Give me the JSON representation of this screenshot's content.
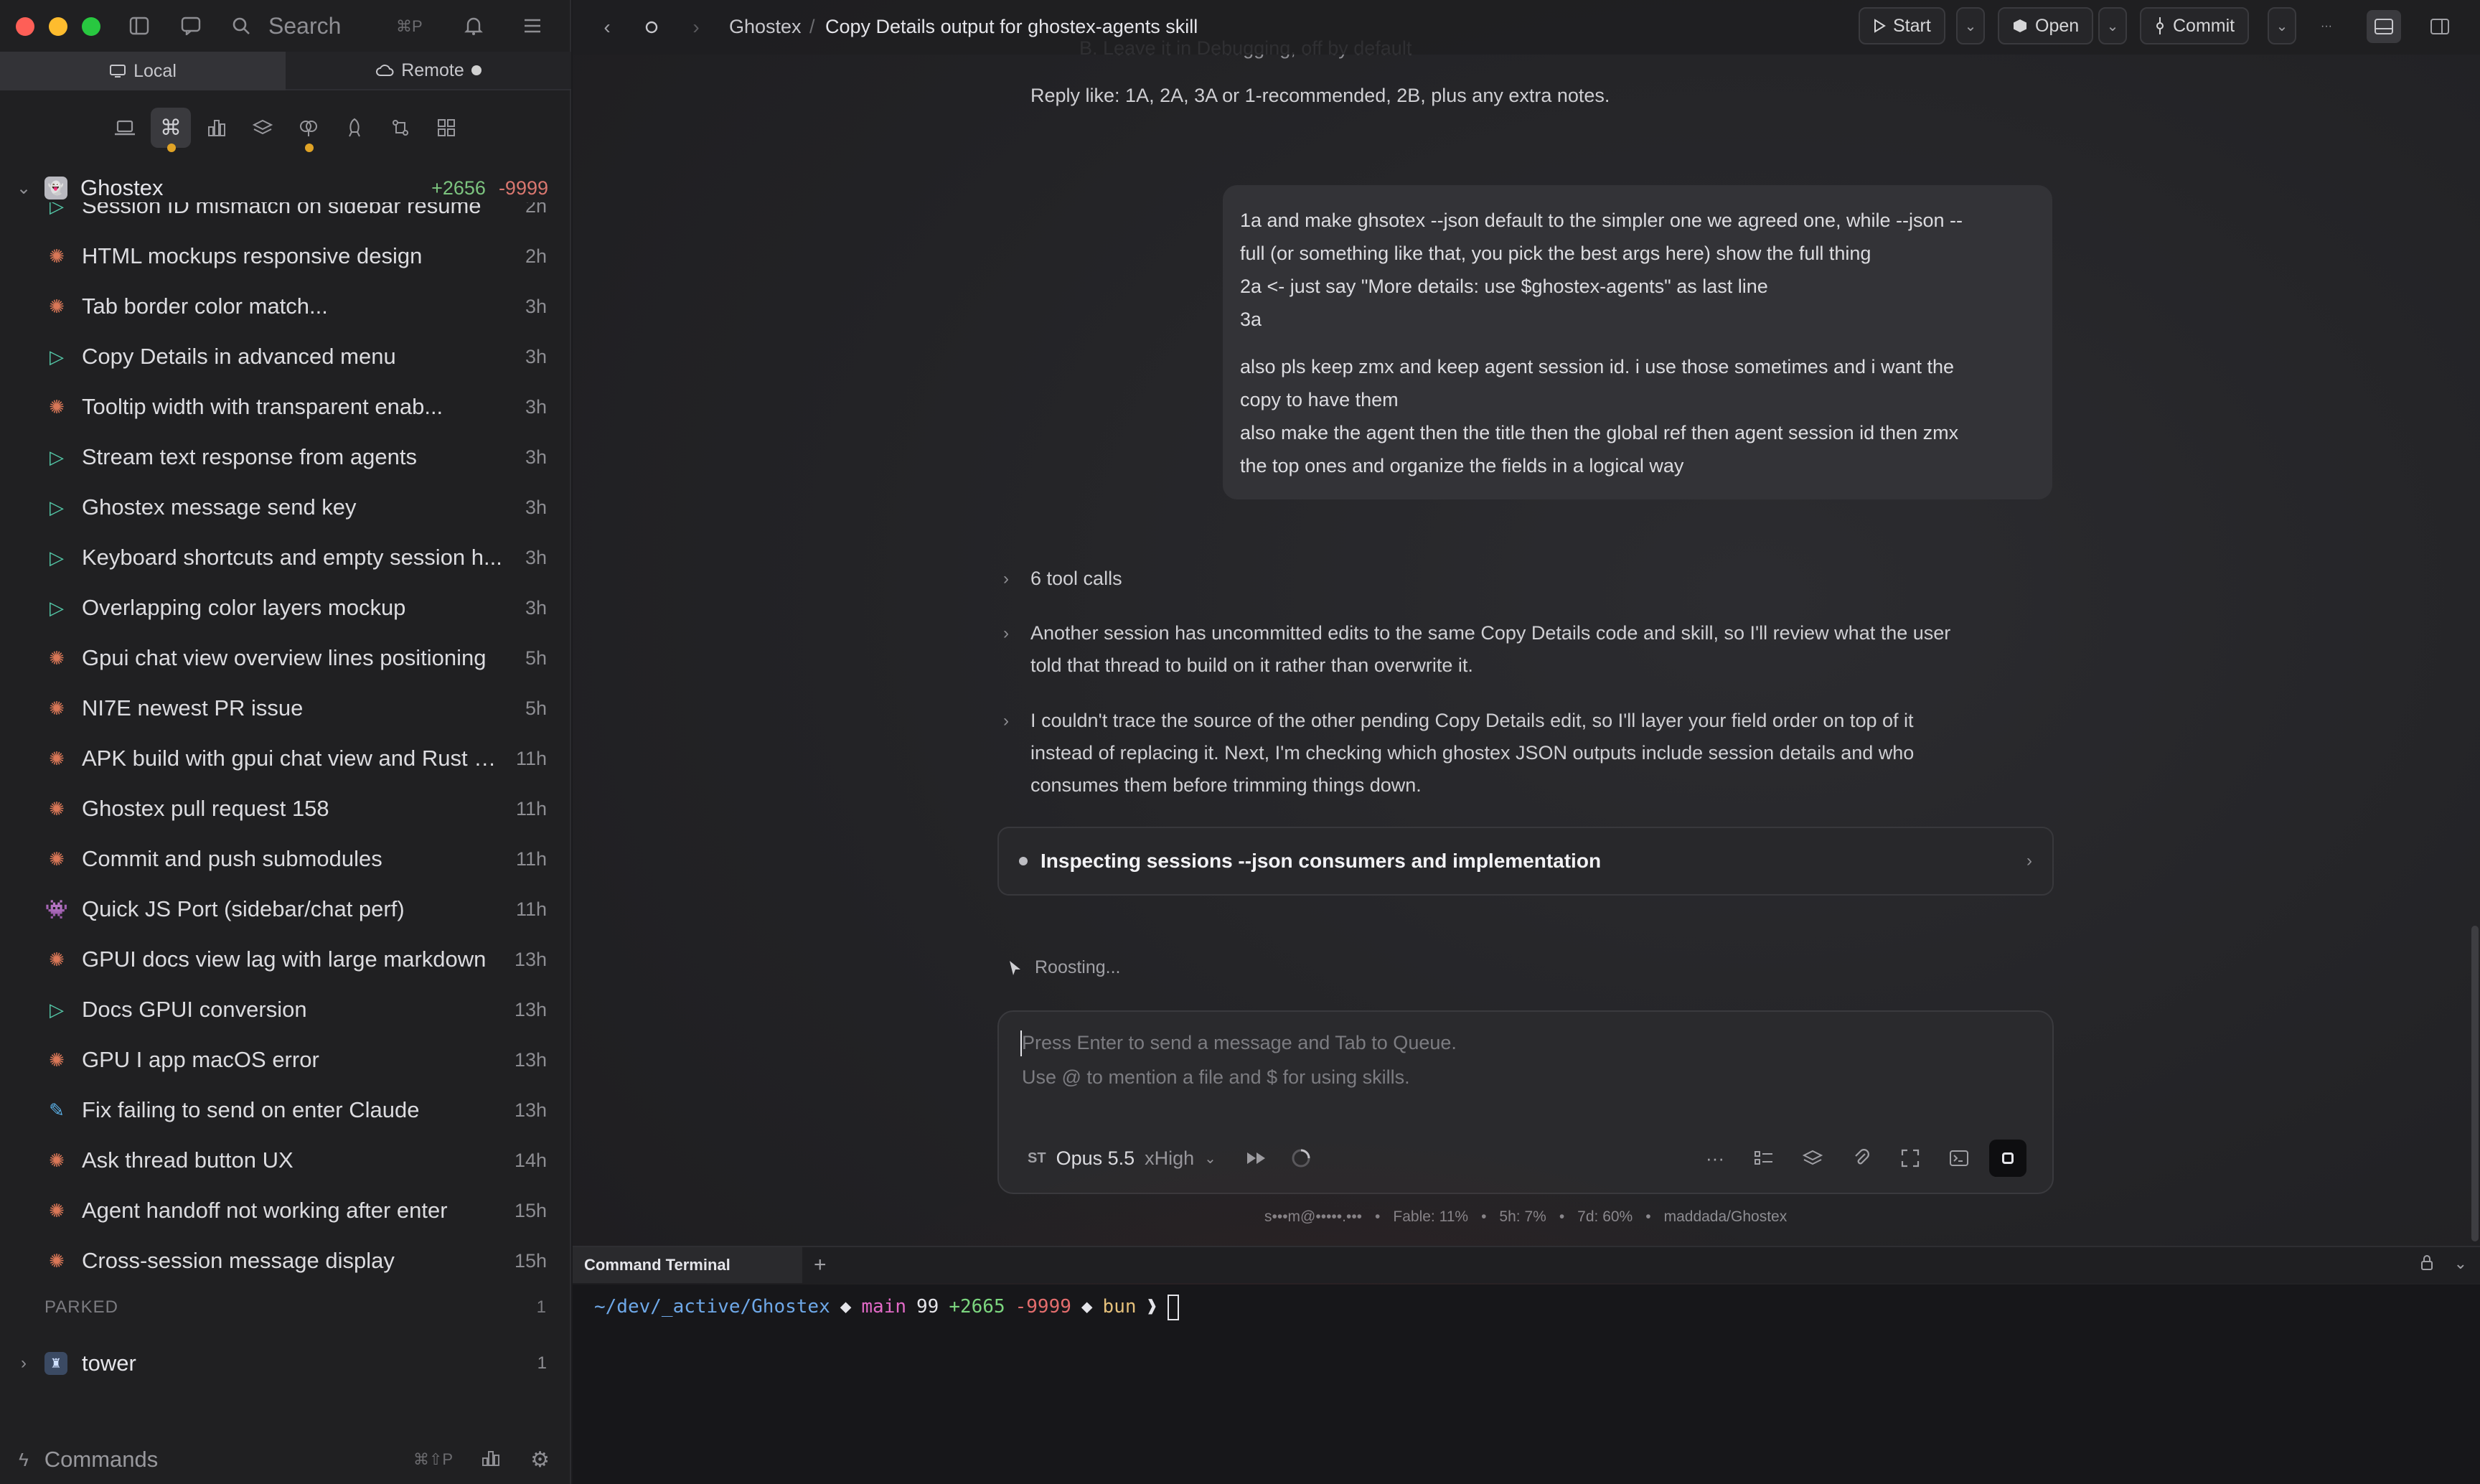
{
  "sidebar": {
    "search": {
      "label": "Search",
      "shortcut": "⌘P"
    },
    "segments": {
      "local": "Local",
      "remote": "Remote"
    },
    "project": {
      "name": "Ghostex",
      "additions": "+2656",
      "deletions": "-9999"
    },
    "sessions": [
      {
        "title": "Session ID mismatch on sidebar resume",
        "time": "2h",
        "icon": "play"
      },
      {
        "title": "HTML mockups responsive design",
        "time": "2h",
        "icon": "burst"
      },
      {
        "title": "Tab border color match...",
        "time": "3h",
        "icon": "burst"
      },
      {
        "title": "Copy Details in advanced menu",
        "time": "3h",
        "icon": "play"
      },
      {
        "title": "Tooltip width with transparent enab...",
        "time": "3h",
        "icon": "burst"
      },
      {
        "title": "Stream text response from agents",
        "time": "3h",
        "icon": "play"
      },
      {
        "title": "Ghostex message send key",
        "time": "3h",
        "icon": "play"
      },
      {
        "title": "Keyboard shortcuts and empty session h...",
        "time": "3h",
        "icon": "play"
      },
      {
        "title": "Overlapping color layers mockup",
        "time": "3h",
        "icon": "play"
      },
      {
        "title": "Gpui chat view overview lines positioning",
        "time": "5h",
        "icon": "burst"
      },
      {
        "title": "NI7E newest PR issue",
        "time": "5h",
        "icon": "burst"
      },
      {
        "title": "APK build with gpui chat view and Rust e...",
        "time": "11h",
        "icon": "burst"
      },
      {
        "title": "Ghostex pull request 158",
        "time": "11h",
        "icon": "burst"
      },
      {
        "title": "Commit and push submodules",
        "time": "11h",
        "icon": "burst"
      },
      {
        "title": "Quick JS Port (sidebar/chat perf)",
        "time": "11h",
        "icon": "ghost"
      },
      {
        "title": "GPUI docs view lag with large markdown",
        "time": "13h",
        "icon": "burst"
      },
      {
        "title": "Docs GPUI conversion",
        "time": "13h",
        "icon": "play"
      },
      {
        "title": "GPU I app macOS error",
        "time": "13h",
        "icon": "burst"
      },
      {
        "title": "Fix failing to send on enter Claude",
        "time": "13h",
        "icon": "brush"
      },
      {
        "title": "Ask thread button UX",
        "time": "14h",
        "icon": "burst"
      },
      {
        "title": "Agent handoff not working after enter",
        "time": "15h",
        "icon": "burst"
      },
      {
        "title": "Cross-session message display",
        "time": "15h",
        "icon": "burst"
      }
    ],
    "parked": {
      "label": "PARKED",
      "count": "1"
    },
    "tower": {
      "name": "tower",
      "count": "1"
    },
    "commands": {
      "label": "Commands",
      "shortcut": "⌘⇧P"
    }
  },
  "topbar": {
    "breadcrumb_root": "Ghostex",
    "breadcrumb_sep": "/",
    "breadcrumb_current": "Copy Details output for ghostex-agents skill",
    "start_label": "Start",
    "open_label": "Open",
    "commit_label": "Commit"
  },
  "chat": {
    "ghost_line": "B. Leave it in Debugging, off by default",
    "reply_line": "Reply like: 1A, 2A, 3A or 1-recommended, 2B, plus any extra notes.",
    "user_message": [
      "1a and make ghsotex --json default to the simpler one we agreed one, while --json --",
      "full (or something like that, you pick the best args here) show the full thing",
      "2a <- just say \"More details: use $ghostex-agents\" as last line",
      "3a",
      "also pls keep zmx and keep agent session id. i use those sometimes and i want the",
      "copy to have them",
      "also make the agent then the title then the global ref then agent session id then zmx",
      "the top ones and organize the fields in a logical way"
    ],
    "tool_calls": "6 tool calls",
    "thought_1": [
      "Another session has uncommitted edits to the same Copy Details code and skill, so I'll review what the user",
      "told that thread to build on it rather than overwrite it."
    ],
    "thought_2": [
      "I couldn't trace the source of the other pending Copy Details edit, so I'll layer your field order on top of it",
      "instead of replacing it. Next, I'm checking which ghostex JSON outputs include session details and who",
      "consumes them before trimming things down."
    ],
    "status_card": "Inspecting sessions --json consumers and implementation",
    "roosting": "Roosting..."
  },
  "composer": {
    "placeholder_1": "Press Enter to send a message and Tab to Queue.",
    "placeholder_2": "Use @ to mention a file and $ for using skills.",
    "model_badge": "ST",
    "model_name": "Opus 5.5",
    "model_effort": "xHigh"
  },
  "usage": {
    "account": "s•••m@•••••.•••",
    "fable": "Fable: 11%",
    "five_h": "5h: 7%",
    "seven_d": "7d: 60%",
    "repo": "maddada/Ghostex"
  },
  "terminal": {
    "tab_label": "Command Terminal",
    "path": "~/dev/_active/Ghostex",
    "branch": "main",
    "changes": "99",
    "additions": "+2665",
    "deletions": "-9999",
    "runtime": "bun"
  },
  "colors": {
    "accent_play": "#54c8a8",
    "accent_claude": "#d97757",
    "additions": "#7cc47f",
    "deletions": "#d9776f"
  }
}
